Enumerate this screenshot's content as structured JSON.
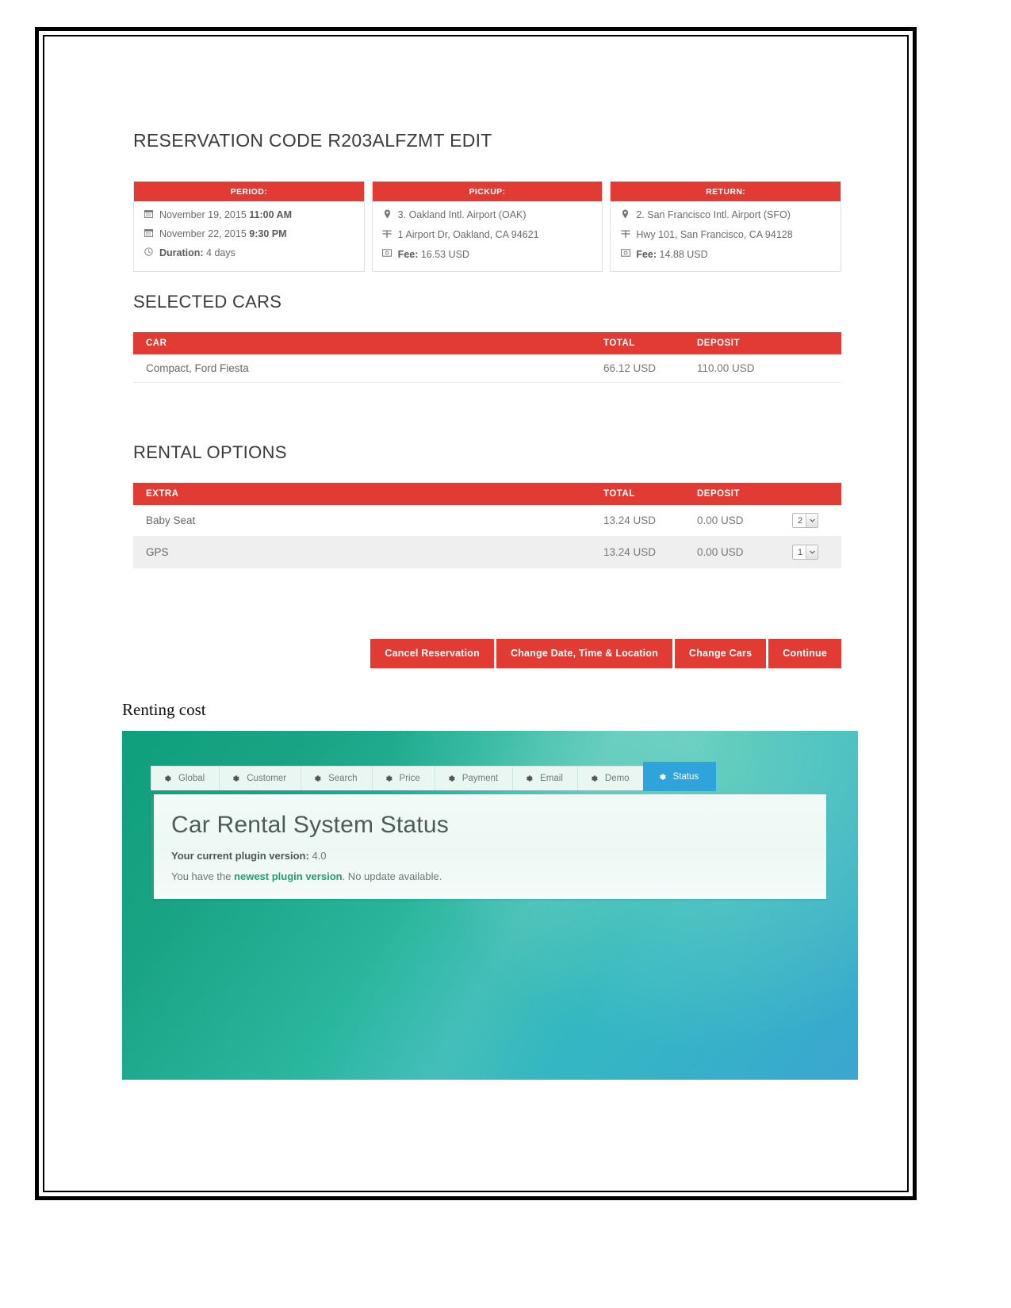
{
  "document": {
    "heading": "RESERVATION CODE R203ALFZMT EDIT",
    "figure_caption": "Renting cost"
  },
  "accent_color": "#e23b33",
  "panels": [
    {
      "title": "PERIOD:",
      "rows": [
        {
          "icon": "calendar-icon",
          "text": "November 19, 2015 ",
          "strong": "11:00 AM",
          "strong_first": false
        },
        {
          "icon": "calendar-icon",
          "text": "November 22, 2015 ",
          "strong": "9:30 PM",
          "strong_first": false
        },
        {
          "icon": "clock-icon",
          "text": " 4 days",
          "strong": "Duration:",
          "strong_first": true
        }
      ]
    },
    {
      "title": "PICKUP:",
      "rows": [
        {
          "icon": "map-pin-icon",
          "text": "3. Oakland Intl. Airport (OAK)",
          "strong": "",
          "strong_first": false
        },
        {
          "icon": "road-icon",
          "text": "1 Airport Dr, Oakland, CA 94621",
          "strong": "",
          "strong_first": false
        },
        {
          "icon": "money-icon",
          "text": " 16.53 USD",
          "strong": "Fee:",
          "strong_first": true
        }
      ]
    },
    {
      "title": "RETURN:",
      "rows": [
        {
          "icon": "map-pin-icon",
          "text": "2. San Francisco Intl. Airport (SFO)",
          "strong": "",
          "strong_first": false
        },
        {
          "icon": "road-icon",
          "text": "Hwy 101, San Francisco, CA 94128",
          "strong": "",
          "strong_first": false
        },
        {
          "icon": "money-icon",
          "text": " 14.88 USD",
          "strong": "Fee:",
          "strong_first": true
        }
      ]
    }
  ],
  "selected_cars": {
    "section_title": "SELECTED CARS",
    "headers": {
      "name": "CAR",
      "total": "TOTAL",
      "deposit": "DEPOSIT"
    },
    "rows": [
      {
        "name": "Compact, Ford Fiesta",
        "total": "66.12 USD",
        "deposit": "110.00 USD"
      }
    ]
  },
  "rental_options": {
    "section_title": "RENTAL OPTIONS",
    "headers": {
      "name": "EXTRA",
      "total": "TOTAL",
      "deposit": "DEPOSIT"
    },
    "rows": [
      {
        "name": "Baby Seat",
        "total": "13.24 USD",
        "deposit": "0.00 USD",
        "qty": "2"
      },
      {
        "name": "GPS",
        "total": "13.24 USD",
        "deposit": "0.00 USD",
        "qty": "1"
      }
    ]
  },
  "actions": {
    "cancel": "Cancel Reservation",
    "change_date": "Change Date, Time & Location",
    "change_cars": "Change Cars",
    "continue": "Continue"
  },
  "plugin_screenshot": {
    "tabs": [
      {
        "label": "Global",
        "active": false
      },
      {
        "label": "Customer",
        "active": false
      },
      {
        "label": "Search",
        "active": false
      },
      {
        "label": "Price",
        "active": false
      },
      {
        "label": "Payment",
        "active": false
      },
      {
        "label": "Email",
        "active": false
      },
      {
        "label": "Demo",
        "active": false
      },
      {
        "label": "Status",
        "active": true
      }
    ],
    "title": "Car Rental System Status",
    "version_label": "Your current plugin version:",
    "version_value": " 4.0",
    "update_prefix": "You have the ",
    "update_strong": "newest plugin version",
    "update_suffix": ". No update available."
  }
}
